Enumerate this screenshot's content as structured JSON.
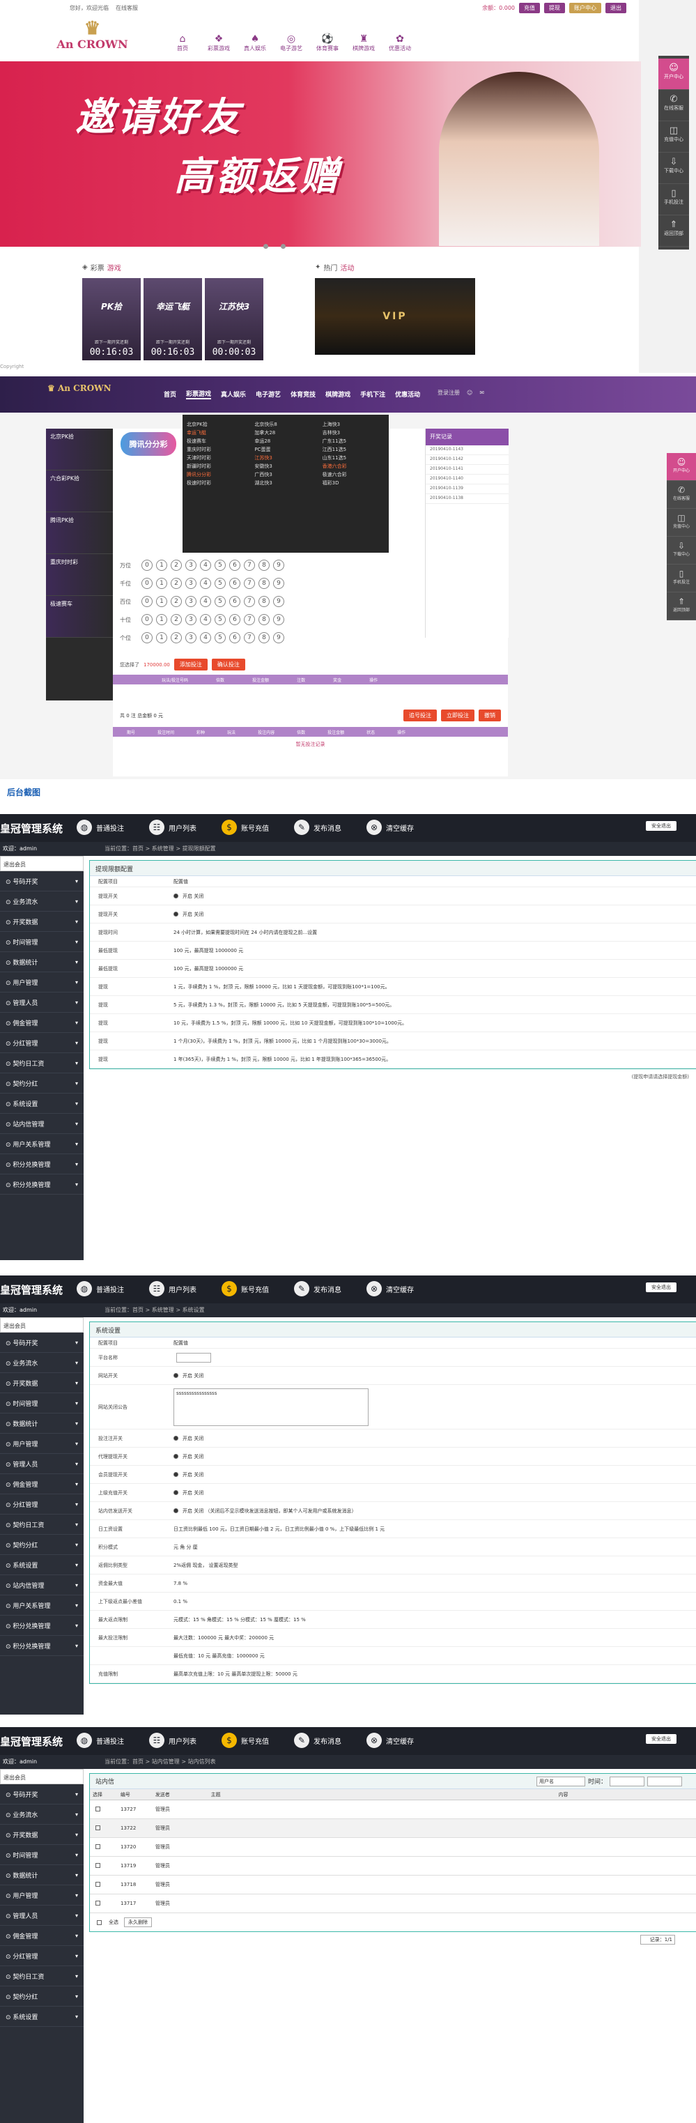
{
  "site": {
    "topbar_left": "您好，欢迎光临",
    "topbar_mid": "在线客服",
    "balance": "余额：0.000",
    "btn_recharge": "充值",
    "btn_withdraw": "提现",
    "btn_bank": "账户中心",
    "btn_logout": "退出",
    "logo_text": "An CROWN",
    "nav": [
      {
        "label": "首页",
        "icon": "home-icon"
      },
      {
        "label": "彩票游戏",
        "icon": "lottery-icon"
      },
      {
        "label": "真人娱乐",
        "icon": "cards-icon"
      },
      {
        "label": "电子游艺",
        "icon": "slot-icon"
      },
      {
        "label": "体育赛事",
        "icon": "sport-icon"
      },
      {
        "label": "棋牌游戏",
        "icon": "chess-icon"
      },
      {
        "label": "优惠活动",
        "icon": "gift-icon"
      }
    ],
    "banner_line1": "邀请好友",
    "banner_line2": "高额返赠",
    "section_lottery": "彩票",
    "section_lottery_acc": "游戏",
    "section_hot": "热门",
    "section_hot_acc": "活动",
    "tiles": [
      {
        "name": "PK拾",
        "sub": "距下一期开奖还剩",
        "time": "00:16:03"
      },
      {
        "name": "幸运飞艇",
        "sub": "距下一期开奖还剩",
        "time": "00:16:03"
      },
      {
        "name": "江苏快3",
        "sub": "距下一期开奖还剩",
        "time": "00:00:03"
      }
    ],
    "vip_text": "VIP",
    "footer_text": "Copyright",
    "sidebar": [
      {
        "label": "开户中心",
        "icon": "user-icon"
      },
      {
        "label": "在线客服",
        "icon": "chat-icon"
      },
      {
        "label": "充值中心",
        "icon": "wallet-icon"
      },
      {
        "label": "下载中心",
        "icon": "download-icon"
      },
      {
        "label": "手机投注",
        "icon": "phone-icon"
      },
      {
        "label": "返回顶部",
        "icon": "top-icon"
      }
    ]
  },
  "game": {
    "nav": [
      "首页",
      "彩票游戏",
      "真人娱乐",
      "电子游艺",
      "体育竞技",
      "棋牌游戏",
      "手机下注",
      "优惠活动"
    ],
    "login": "登录注册",
    "left_games": [
      "北京PK拾",
      "六合彩PK拾",
      "腾讯PK拾",
      "重庆时时彩",
      "极速赛车"
    ],
    "dropdown": [
      {
        "t": "北京PK拾",
        "hot": false
      },
      {
        "t": "幸运飞艇",
        "hot": true
      },
      {
        "t": "极速赛车",
        "hot": false
      },
      {
        "t": "重庆时时彩",
        "hot": false
      },
      {
        "t": "天津时时彩",
        "hot": false
      },
      {
        "t": "新疆时时彩",
        "hot": false
      },
      {
        "t": "腾讯分分彩",
        "hot": true
      },
      {
        "t": "极速时时彩",
        "hot": false
      },
      {
        "t": "北京快乐8",
        "hot": false
      },
      {
        "t": "加拿大28",
        "hot": false
      },
      {
        "t": "幸运28",
        "hot": false
      },
      {
        "t": "PC蛋蛋",
        "hot": false
      },
      {
        "t": "江苏快3",
        "hot": true
      },
      {
        "t": "安徽快3",
        "hot": false
      },
      {
        "t": "广西快3",
        "hot": false
      },
      {
        "t": "湖北快3",
        "hot": false
      },
      {
        "t": "上海快3",
        "hot": false
      },
      {
        "t": "吉林快3",
        "hot": false
      },
      {
        "t": "广东11选5",
        "hot": false
      },
      {
        "t": "江西11选5",
        "hot": false
      },
      {
        "t": "山东11选5",
        "hot": false
      },
      {
        "t": "香港六合彩",
        "hot": true
      },
      {
        "t": "极速六合彩",
        "hot": false
      },
      {
        "t": "福彩3D",
        "hot": false
      }
    ],
    "lottery_title": "腾讯分分彩",
    "ball_rows": [
      "万位",
      "千位",
      "百位",
      "十位",
      "个位"
    ],
    "balls": [
      "0",
      "1",
      "2",
      "3",
      "4",
      "5",
      "6",
      "7",
      "8",
      "9"
    ],
    "right_head": "开奖记录",
    "right_rows": [
      "20190410-1143",
      "20190410-1142",
      "20190410-1141",
      "20190410-1140",
      "20190410-1139",
      "20190410-1138"
    ],
    "bet_label": "您选择了",
    "bet_amount": "170000.00",
    "btn_add": "添加投注",
    "btn_confirm": "确认投注",
    "table_heads": [
      "玩法/投注号码",
      "倍数",
      "投注金额",
      "注数",
      "奖金",
      "操作"
    ],
    "bottom_info": "共 0 注  总金额 0 元",
    "btn_bottom1": "追号投注",
    "btn_bottom2": "立即投注",
    "btn_bottom3": "撤销",
    "bottom_heads": [
      "期号",
      "投注时间",
      "彩种",
      "玩法",
      "投注内容",
      "倍数",
      "投注金额",
      "状态",
      "操作"
    ],
    "bottom_empty": "暂无投注记录",
    "sidebar": [
      "开户中心",
      "在线客服",
      "充值中心",
      "下载中心",
      "手机投注",
      "返回顶部"
    ]
  },
  "heading": "后台截图",
  "admin": {
    "title": "皇冠管理系统",
    "toolbar": [
      {
        "label": "普通投注",
        "icon": "globe-icon"
      },
      {
        "label": "用户列表",
        "icon": "users-icon"
      },
      {
        "label": "账号充值",
        "icon": "moneybag-icon"
      },
      {
        "label": "发布消息",
        "icon": "edit-icon"
      },
      {
        "label": "清空缓存",
        "icon": "clear-icon"
      }
    ],
    "exit": "安全退出",
    "user": "欢迎：admin",
    "side_head": "退出会员",
    "menu": [
      "号码开奖",
      "业务流水",
      "开奖数据",
      "时间管理",
      "数据统计",
      "用户管理",
      "管理人员",
      "佣金管理",
      "分红管理",
      "契约日工资",
      "契约分红",
      "系统设置",
      "站内信管理",
      "用户关系管理",
      "积分兑换管理",
      "积分兑换管理"
    ],
    "p1": {
      "breadcrumb": "当前位置：首页 > 系统管理 > 提现限额配置",
      "box_title": "提现限额配置",
      "col_k": "配置项目",
      "col_v": "配置值",
      "rows": [
        {
          "k": "提现开关",
          "v": "开启  关闭"
        },
        {
          "k": "提现开关",
          "v": "开启  关闭"
        },
        {
          "k": "提现时间",
          "v": "24  小时计算，如果需要提现时间在 24 小时内请在提现之前...设置"
        },
        {
          "k": "最低提现",
          "v": "100  元，最高提现 1000000 元"
        },
        {
          "k": "最低提现",
          "v": "100  元，最高提现 1000000 元"
        },
        {
          "k": "提现",
          "v": "1  元，手续费为 1  %，封顶  元，限额 10000 元，比如 1 天提现金额，可提现到账100*1=100元。"
        },
        {
          "k": "提现",
          "v": "5  元，手续费为 1.3 %，封顶  元，限额 10000 元，比如 5 天提现金额，可提现到账100*5=500元。"
        },
        {
          "k": "提现",
          "v": "10  元，手续费为 1.5 %，封顶  元，限额 10000 元，比如 10 天提现金额，可提现到账100*10=1000元。"
        },
        {
          "k": "提现",
          "v": "1  个月(30天)，手续费为 1  %，封顶  元，限额 10000 元，比如 1 个月提现到账100*30=3000元。"
        },
        {
          "k": "提现",
          "v": "1  年(365天)，手续费为 1  %，封顶  元，限额 10000 元，比如 1 年提现到账100*365=36500元。"
        }
      ],
      "note": "(提现申请请选择提现金额)"
    },
    "p2": {
      "breadcrumb": "当前位置：首页 > 系统管理 > 系统设置",
      "box_title": "系统设置",
      "col_k": "配置项目",
      "col_v": "配置值",
      "rows": [
        {
          "k": "平台名称",
          "v": ""
        },
        {
          "k": "网站开关",
          "v": "开启  关闭"
        },
        {
          "k": "网站关闭公告",
          "v": "ssssssssssssssss"
        },
        {
          "k": "投注注开关",
          "v": "开启  关闭"
        },
        {
          "k": "代理提现开关",
          "v": "开启  关闭"
        },
        {
          "k": "会员提现开关",
          "v": "开启  关闭"
        },
        {
          "k": "上级充值开关",
          "v": "开启  关闭"
        },
        {
          "k": "站内信发送开关",
          "v": "开启  关闭 （关闭后不显示模块发送消息按钮，即某个人可发用户或系统发消息）"
        },
        {
          "k": "日工资设置",
          "v": "日工资比例最低 100 元，日工资日期最小值 2  元，日工资比例最小值 0  %，上下级最低比例 1  元"
        },
        {
          "k": "积分模式",
          "v": "元  角  分  厘"
        },
        {
          "k": "返佣比例类型",
          "v": "2%返佣  现金，  设置返现类型"
        },
        {
          "k": "资金最大值",
          "v": "7.8  %"
        },
        {
          "k": "上下级返点最小差值",
          "v": "0.1  %"
        },
        {
          "k": "最大返点限制",
          "v": "元模式：15  %  角模式：15  %  分模式：15  %  厘模式：15  %"
        },
        {
          "k": "最大投注限制",
          "v": "最大注数：100000  元  最大中奖：200000  元"
        },
        {
          "k": "",
          "v": "最低充值：10  元  最高充值：1000000  元"
        },
        {
          "k": "充值限制",
          "v": "最高单次充值上限：10  元  最高单次提现上限：50000  元"
        }
      ]
    },
    "p3": {
      "breadcrumb": "当前位置：首页 > 站内信管理 > 站内信列表",
      "box_title": "站内信",
      "filter_user": "用户名",
      "filter_date": "时间：",
      "col_heads": [
        "选择",
        "编号",
        "发送者",
        "主题",
        "内容",
        ""
      ],
      "rows": [
        {
          "id": "13727",
          "from": "管理员"
        },
        {
          "id": "13722",
          "from": "管理员"
        },
        {
          "id": "13720",
          "from": "管理员"
        },
        {
          "id": "13719",
          "from": "管理员"
        },
        {
          "id": "13718",
          "from": "管理员"
        },
        {
          "id": "13717",
          "from": "管理员"
        }
      ],
      "select_all": "全选",
      "btn_delete": "永久删除",
      "pager": "记录：1/1"
    },
    "menu3": [
      "号码开奖",
      "业务流水",
      "开奖数据",
      "时间管理",
      "数据统计",
      "用户管理",
      "管理人员",
      "佣金管理",
      "分红管理",
      "契约日工资",
      "契约分红",
      "系统设置"
    ]
  },
  "colors": {
    "purple": "#8b3a86",
    "pink": "#d34c8d",
    "admin_dark": "#1e2129",
    "teal": "#3bb7a8"
  }
}
